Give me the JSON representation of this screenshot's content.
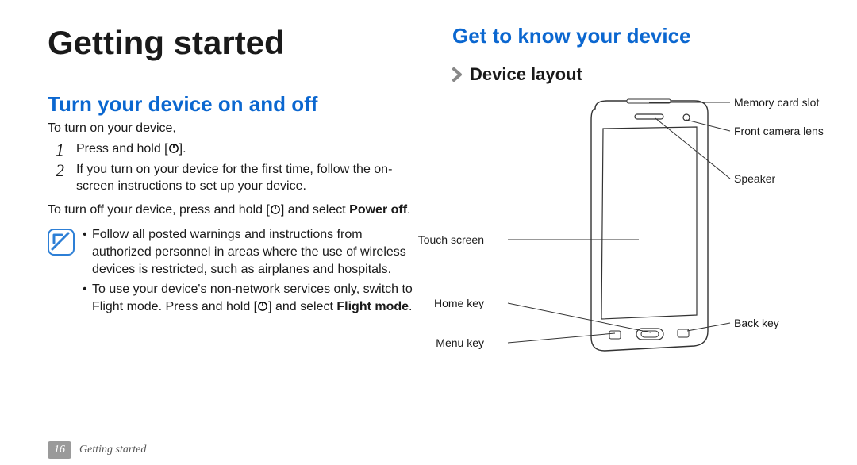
{
  "page_title": "Getting started",
  "left": {
    "section_title": "Turn your device on and off",
    "intro": "To turn on your device,",
    "steps": [
      "Press and hold [",
      "If you turn on your device for the first time, follow the on-screen instructions to set up your device."
    ],
    "step1_tail": "].",
    "turn_off_a": "To turn off your device, press and hold [",
    "turn_off_b": "] and select ",
    "turn_off_bold": "Power off",
    "turn_off_c": ".",
    "notes": [
      "Follow all posted warnings and instructions from authorized personnel in areas where the use of wireless devices is restricted, such as airplanes and hospitals.",
      ""
    ],
    "note2_a": "To use your device's non-network services only, switch to Flight mode. Press and hold [",
    "note2_b": "] and select ",
    "note2_bold": "Flight mode",
    "note2_c": "."
  },
  "right": {
    "section_title": "Get to know your device",
    "sub_title": "Device layout",
    "callouts": {
      "memory_card_slot": "Memory card slot",
      "front_camera": "Front camera lens",
      "speaker": "Speaker",
      "touch_screen": "Touch screen",
      "home_key": "Home key",
      "menu_key": "Menu key",
      "back_key": "Back key"
    }
  },
  "footer": {
    "page_number": "16",
    "section": "Getting started"
  },
  "icons": {
    "power": "power-icon",
    "note": "note-icon",
    "chevron": "chevron-icon"
  }
}
